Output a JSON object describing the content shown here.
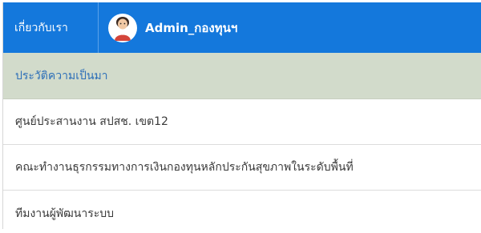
{
  "header": {
    "about_label": "เกี่ยวกับเรา",
    "user_name": "Admin_กองทุนฯ",
    "avatar_icon": "user-avatar-icon",
    "brand_color": "#1478dc"
  },
  "menu": {
    "items": [
      {
        "label": "ประวัติความเป็นมา",
        "active": true
      },
      {
        "label": "ศูนย์ประสานงาน สปสช. เขต12",
        "active": false
      },
      {
        "label": "คณะทำงานธุรกรรมทางการเงินกองทุนหลักประกันสุขภาพในระดับพื้นที่",
        "active": false
      },
      {
        "label": "ทีมงานผู้พัฒนาระบบ",
        "active": false
      }
    ],
    "active_bg": "#d2dbcb",
    "active_text": "#2d6fb8"
  }
}
